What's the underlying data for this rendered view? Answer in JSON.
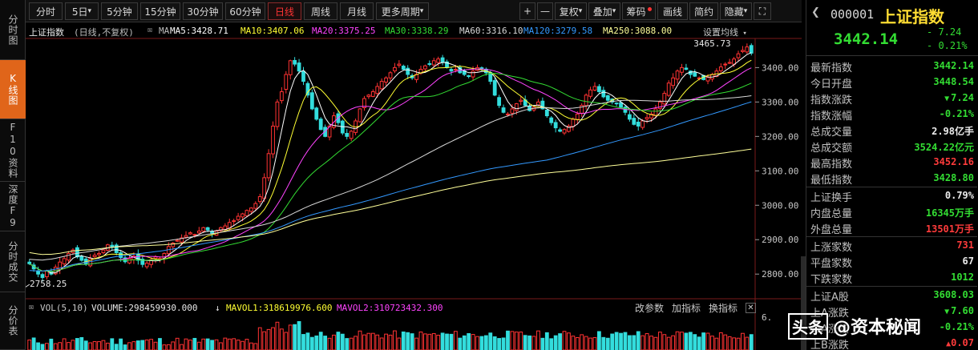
{
  "left_nav": [
    {
      "label": "分时图",
      "active": false
    },
    {
      "label": "K线图",
      "active": true
    },
    {
      "label": "F10资料",
      "active": false
    },
    {
      "label": "深度F9",
      "active": false
    },
    {
      "label": "分时成交",
      "active": false
    },
    {
      "label": "分价表",
      "active": false
    }
  ],
  "toolbar": {
    "periods": [
      "分时",
      "5日",
      "5分钟",
      "15分钟",
      "30分钟",
      "60分钟",
      "日线",
      "周线",
      "月线",
      "更多周期"
    ],
    "active_period": "日线",
    "tools": [
      "+",
      "—",
      "复权",
      "叠加",
      "筹码",
      "画线",
      "简约",
      "隐藏",
      "⛶"
    ]
  },
  "chart": {
    "title": "上证指数",
    "mode": "(日线,不复权)",
    "ma_label": "MA",
    "settings_label": "设置均线",
    "ma_lines": [
      {
        "name": "MA5",
        "text": "MA5:3428.71",
        "color": "#ffffff"
      },
      {
        "name": "MA10",
        "text": "MA10:3407.06",
        "color": "#ffff33"
      },
      {
        "name": "MA20",
        "text": "MA20:3375.25",
        "color": "#ff44ff"
      },
      {
        "name": "MA30",
        "text": "MA30:3338.29",
        "color": "#33dd33"
      },
      {
        "name": "MA60",
        "text": "MA60:3316.10",
        "color": "#d8d8d8"
      },
      {
        "name": "MA120",
        "text": "MA120:3279.58",
        "color": "#3399ff"
      },
      {
        "name": "MA250",
        "text": "MA250:3088.00",
        "color": "#ffff99"
      }
    ],
    "high_annotation": "3465.73",
    "low_annotation": "2758.25",
    "y_ticks": [
      "3400.00",
      "3300.00",
      "3200.00",
      "3100.00",
      "3000.00",
      "2900.00",
      "2800.00"
    ]
  },
  "chart_data": {
    "type": "candlestick",
    "title": "上证指数",
    "ylim": [
      2740,
      3480
    ],
    "y_ticks": [
      3400,
      3300,
      3200,
      3100,
      3000,
      2900,
      2800
    ],
    "high": 3465.73,
    "low": 2758.25,
    "closes": [
      2830,
      2815,
      2800,
      2790,
      2810,
      2800,
      2820,
      2835,
      2845,
      2860,
      2870,
      2850,
      2840,
      2830,
      2845,
      2855,
      2860,
      2870,
      2885,
      2878,
      2862,
      2848,
      2836,
      2845,
      2852,
      2840,
      2828,
      2832,
      2842,
      2850,
      2845,
      2860,
      2880,
      2890,
      2898,
      2905,
      2912,
      2920,
      2915,
      2925,
      2935,
      2928,
      2918,
      2925,
      2935,
      2940,
      2950,
      2955,
      2968,
      2975,
      2985,
      2992,
      3005,
      3025,
      3080,
      3150,
      3230,
      3300,
      3330,
      3380,
      3420,
      3410,
      3390,
      3360,
      3320,
      3280,
      3250,
      3220,
      3200,
      3230,
      3260,
      3240,
      3210,
      3200,
      3215,
      3245,
      3280,
      3310,
      3320,
      3330,
      3345,
      3360,
      3370,
      3385,
      3400,
      3410,
      3395,
      3380,
      3370,
      3380,
      3395,
      3405,
      3410,
      3420,
      3425,
      3415,
      3400,
      3390,
      3395,
      3385,
      3380,
      3375,
      3390,
      3400,
      3398,
      3385,
      3360,
      3320,
      3290,
      3270,
      3265,
      3280,
      3295,
      3305,
      3290,
      3275,
      3285,
      3300,
      3280,
      3260,
      3240,
      3225,
      3215,
      3220,
      3230,
      3250,
      3265,
      3290,
      3320,
      3335,
      3345,
      3330,
      3315,
      3305,
      3300,
      3295,
      3285,
      3270,
      3250,
      3235,
      3230,
      3245,
      3255,
      3265,
      3280,
      3300,
      3325,
      3355,
      3370,
      3390,
      3400,
      3395,
      3380,
      3375,
      3370,
      3365,
      3372,
      3380,
      3390,
      3402,
      3410,
      3415,
      3425,
      3440,
      3450,
      3460,
      3442
    ],
    "ma_series": [
      "MA5",
      "MA10",
      "MA20",
      "MA30",
      "MA60",
      "MA120",
      "MA250"
    ],
    "ma_last": [
      3428.71,
      3407.06,
      3375.25,
      3338.29,
      3316.1,
      3279.58,
      3088.0
    ],
    "volume": {
      "label": "VOL(5,10)",
      "volume": "VOLUME:298459930.000",
      "mavol1": "MAVOL1:318619976.600",
      "mavol2": "MAVOL2:310723432.300"
    }
  },
  "volume_panel": {
    "vol_label": "VOL(5,10)",
    "volume_text": "VOLUME:298459930.000",
    "mavol1_text": "MAVOL1:318619976.600",
    "mavol2_text": "MAVOL2:310723432.300",
    "buttons": [
      "改参数",
      "加指标",
      "换指标"
    ],
    "axis_label": "6."
  },
  "quote": {
    "code": "000001",
    "name": "上证指数",
    "price": "3442.14",
    "change": "- 7.24",
    "change_pct": "- 0.21%",
    "rows": [
      {
        "label": "最新指数",
        "value": "3442.14",
        "color": "green"
      },
      {
        "label": "今日开盘",
        "value": "3448.54",
        "color": "green"
      },
      {
        "label": "指数涨跌",
        "value": "7.24",
        "color": "green",
        "arrow": true
      },
      {
        "label": "指数涨幅",
        "value": "-0.21%",
        "color": "green"
      },
      {
        "label": "总成交量",
        "value": "2.98亿手",
        "color": "white"
      },
      {
        "label": "总成交额",
        "value": "3524.22亿元",
        "color": "green"
      },
      {
        "label": "最高指数",
        "value": "3452.16",
        "color": "red"
      },
      {
        "label": "最低指数",
        "value": "3428.80",
        "color": "green"
      },
      {
        "label": "上证换手",
        "value": "0.79%",
        "color": "white"
      },
      {
        "label": "内盘总量",
        "value": "16345万手",
        "color": "green"
      },
      {
        "label": "外盘总量",
        "value": "13501万手",
        "color": "red"
      },
      {
        "label": "上涨家数",
        "value": "731",
        "color": "red"
      },
      {
        "label": "平盘家数",
        "value": "67",
        "color": "white"
      },
      {
        "label": "下跌家数",
        "value": "1012",
        "color": "green"
      },
      {
        "label": "上证A股",
        "value": "3608.03",
        "color": "green"
      },
      {
        "label": "上A涨跌",
        "value": "7.60",
        "color": "green",
        "arrow": true
      },
      {
        "label": "上A涨幅",
        "value": "-0.21%",
        "color": "green"
      },
      {
        "label": "上B涨跌",
        "value": "0.07",
        "color": "red",
        "arrow": true
      }
    ]
  },
  "watermark": {
    "box": "头条",
    "text": "@资本秘闻"
  }
}
